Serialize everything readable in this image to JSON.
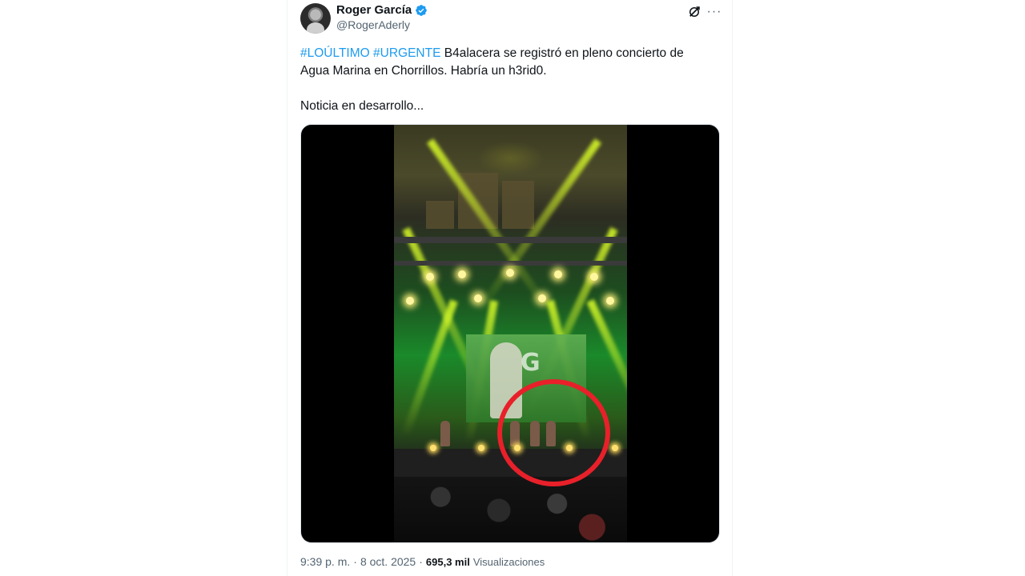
{
  "author": {
    "display_name": "Roger García",
    "handle": "@RogerAderly",
    "verified": true,
    "avatar_icon": "user-avatar"
  },
  "tweet": {
    "hashtags": [
      "#LOÚLTIMO",
      "#URGENTE"
    ],
    "body_line1": "B4alacera se registró en pleno concierto de",
    "body_line2": "Agua Marina en Chorrillos. Habría un h3rid0.",
    "body_line3": "Noticia en desarrollo...",
    "media": {
      "type": "video",
      "highlight_color": "#e8202a",
      "overlay_logo": "G"
    }
  },
  "meta": {
    "time": "9:39 p. m.",
    "separator": "·",
    "date": "8 oct. 2025",
    "views_count": "695,3 mil",
    "views_label": "Visualizaciones"
  },
  "icons": {
    "verified": "verified-badge-icon",
    "grok": "grok-icon",
    "more": "more-options-icon",
    "more_glyph": "···"
  },
  "colors": {
    "link": "#1d9bf0",
    "text": "#0f1419",
    "secondary": "#536471",
    "verified": "#1d9bf0"
  }
}
